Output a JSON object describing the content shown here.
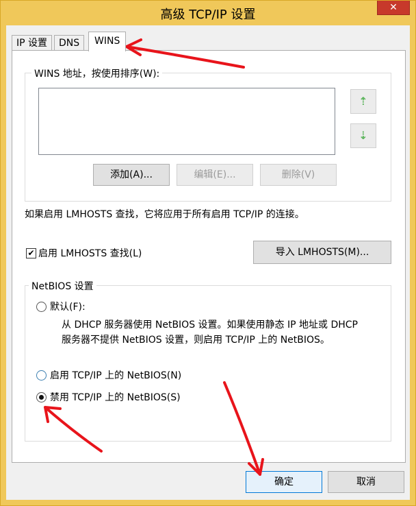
{
  "window": {
    "title": "高级 TCP/IP 设置",
    "close_label": "✕"
  },
  "tabs": [
    {
      "label": "IP 设置",
      "active": false
    },
    {
      "label": "DNS",
      "active": false
    },
    {
      "label": "WINS",
      "active": true
    }
  ],
  "wins": {
    "group_label": "WINS 地址，按使用排序(W):",
    "addresses": [],
    "up_icon": "arrow-up-icon",
    "down_icon": "arrow-down-icon",
    "up_glyph": "⇡",
    "down_glyph": "⇣",
    "add_label": "添加(A)...",
    "edit_label": "编辑(E)...",
    "remove_label": "删除(V)"
  },
  "lmhosts": {
    "info_text": "如果启用 LMHOSTS 查找，它将应用于所有启用 TCP/IP 的连接。",
    "enable_label": "启用 LMHOSTS 查找(L)",
    "enable_checked": true,
    "check_glyph": "✔",
    "import_label": "导入 LMHOSTS(M)..."
  },
  "netbios": {
    "group_label": "NetBIOS 设置",
    "options": [
      {
        "label": "默认(F):",
        "checked": false
      },
      {
        "label": "启用 TCP/IP 上的 NetBIOS(N)",
        "checked": false
      },
      {
        "label": "禁用 TCP/IP 上的 NetBIOS(S)",
        "checked": true
      }
    ],
    "default_desc_line1": "从 DHCP 服务器使用 NetBIOS 设置。如果使用静态 IP 地址或 DHCP",
    "default_desc_line2": "服务器不提供 NetBIOS 设置，则启用 TCP/IP 上的 NetBIOS。"
  },
  "footer": {
    "ok_label": "确定",
    "cancel_label": "取消"
  },
  "colors": {
    "title_bar": "#f0c85a",
    "annotation_arrow": "#e8141b",
    "close_button": "#c7392b"
  }
}
